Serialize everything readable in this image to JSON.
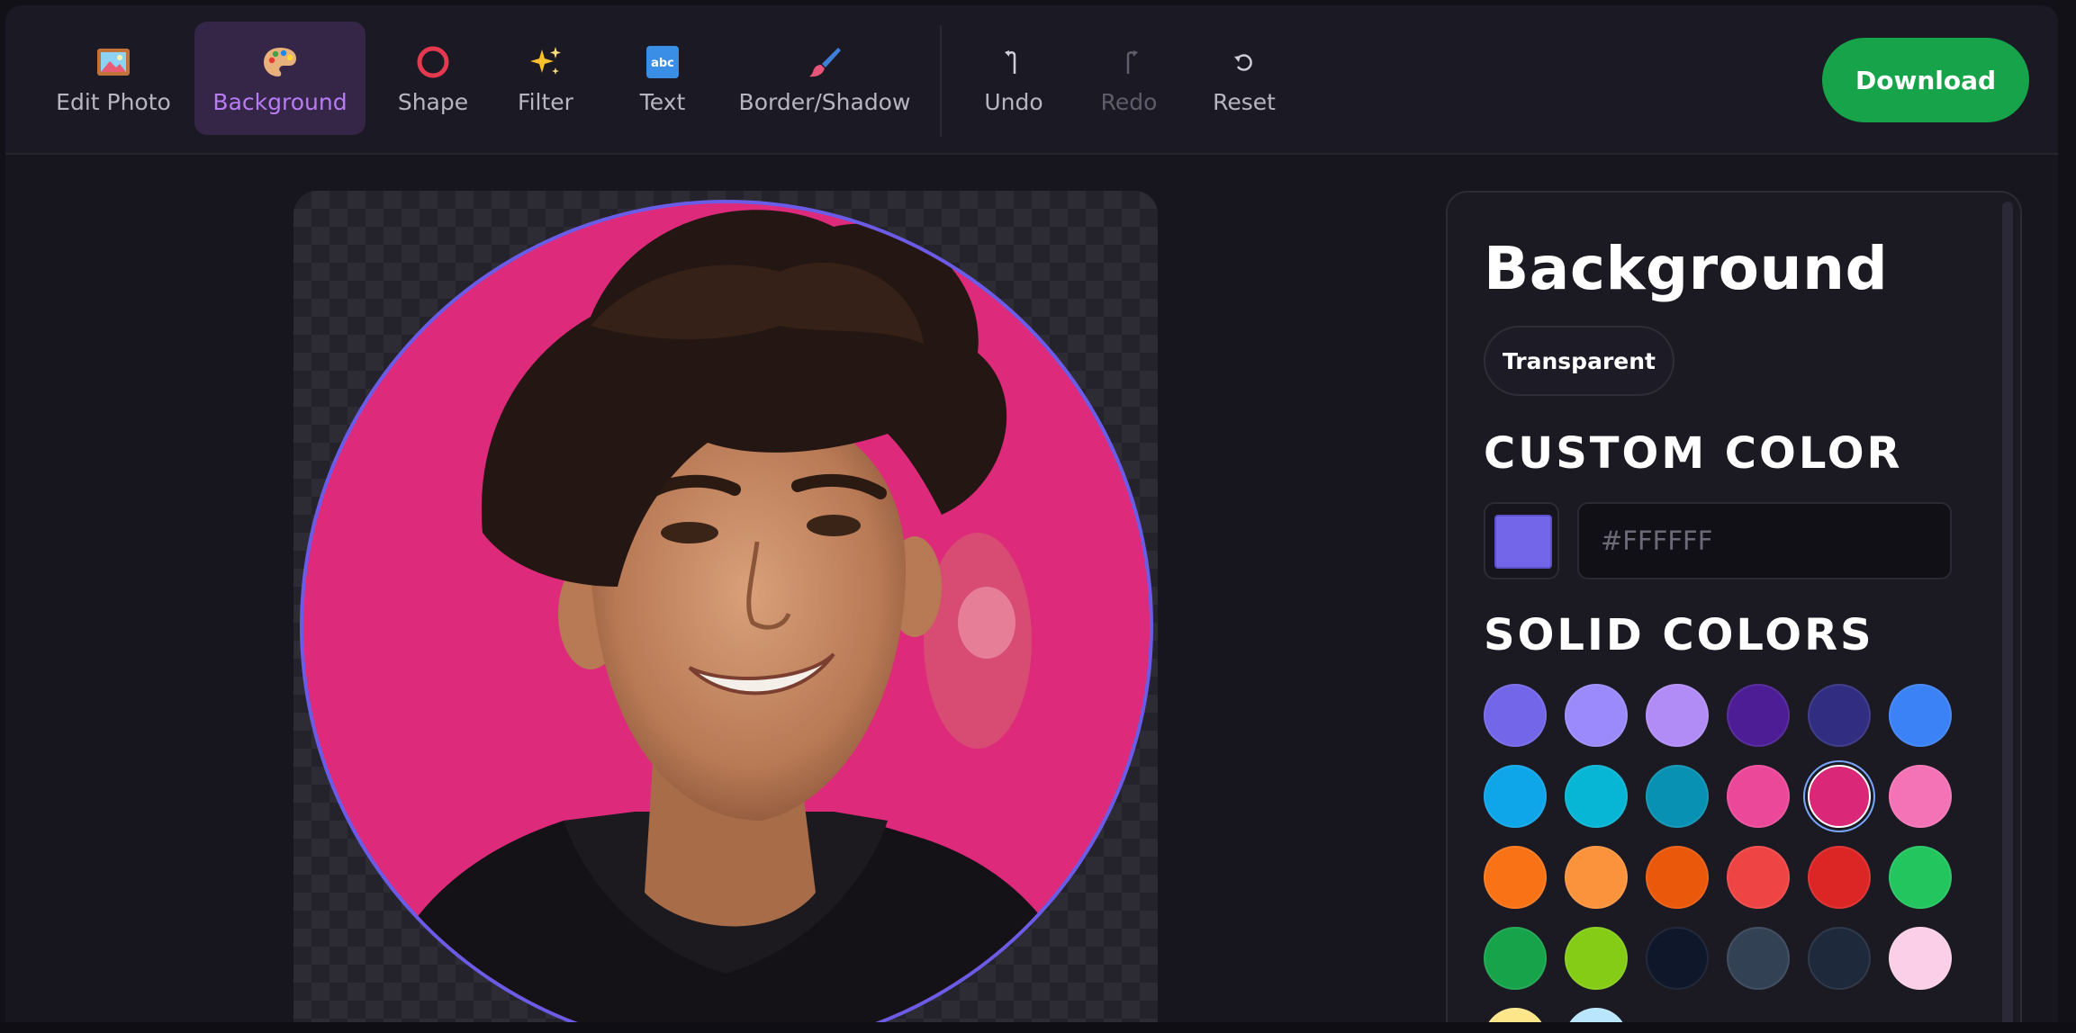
{
  "toolbar": {
    "tools": [
      {
        "label": "Edit Photo",
        "icon": "picture-frame-icon",
        "state": "normal"
      },
      {
        "label": "Background",
        "icon": "palette-icon",
        "state": "active"
      },
      {
        "label": "Shape",
        "icon": "circle-icon",
        "state": "normal"
      },
      {
        "label": "Filter",
        "icon": "sparkles-icon",
        "state": "normal"
      },
      {
        "label": "Text",
        "icon": "abc-icon",
        "state": "normal"
      },
      {
        "label": "Border/Shadow",
        "icon": "paintbrush-icon",
        "state": "normal"
      }
    ],
    "history": [
      {
        "label": "Undo",
        "icon": "undo-arrow-icon",
        "state": "normal"
      },
      {
        "label": "Redo",
        "icon": "redo-arrow-icon",
        "state": "disabled"
      },
      {
        "label": "Reset",
        "icon": "reset-icon",
        "state": "normal"
      }
    ],
    "download_label": "Download",
    "download_color": "#16a34a",
    "active_color": "#b77cf2"
  },
  "canvas": {
    "border_color": "#6b5ce7",
    "background_color": "#dd2a7b"
  },
  "panel": {
    "title": "Background",
    "transparent_label": "Transparent",
    "custom_color_heading": "CUSTOM COLOR",
    "custom_color_value": "#7366e8",
    "hex_placeholder": "#FFFFFF",
    "solid_colors_heading": "SOLID COLORS",
    "solid_colors": [
      "#7366e8",
      "#9b8afb",
      "#b18cf7",
      "#4c1d95",
      "#312e81",
      "#3b82f6",
      "#0ea5e9",
      "#06b6d4",
      "#0891b2",
      "#ec4899",
      "#db2777",
      "#f472b6",
      "#f97316",
      "#fb923c",
      "#ea580c",
      "#ef4444",
      "#dc2626",
      "#22c55e",
      "#16a34a",
      "#84cc16",
      "#0f172a",
      "#334155",
      "#1e293b",
      "#fbcfe8",
      "#fde68a",
      "#bae6fd"
    ],
    "selected_color": "#db2777"
  }
}
